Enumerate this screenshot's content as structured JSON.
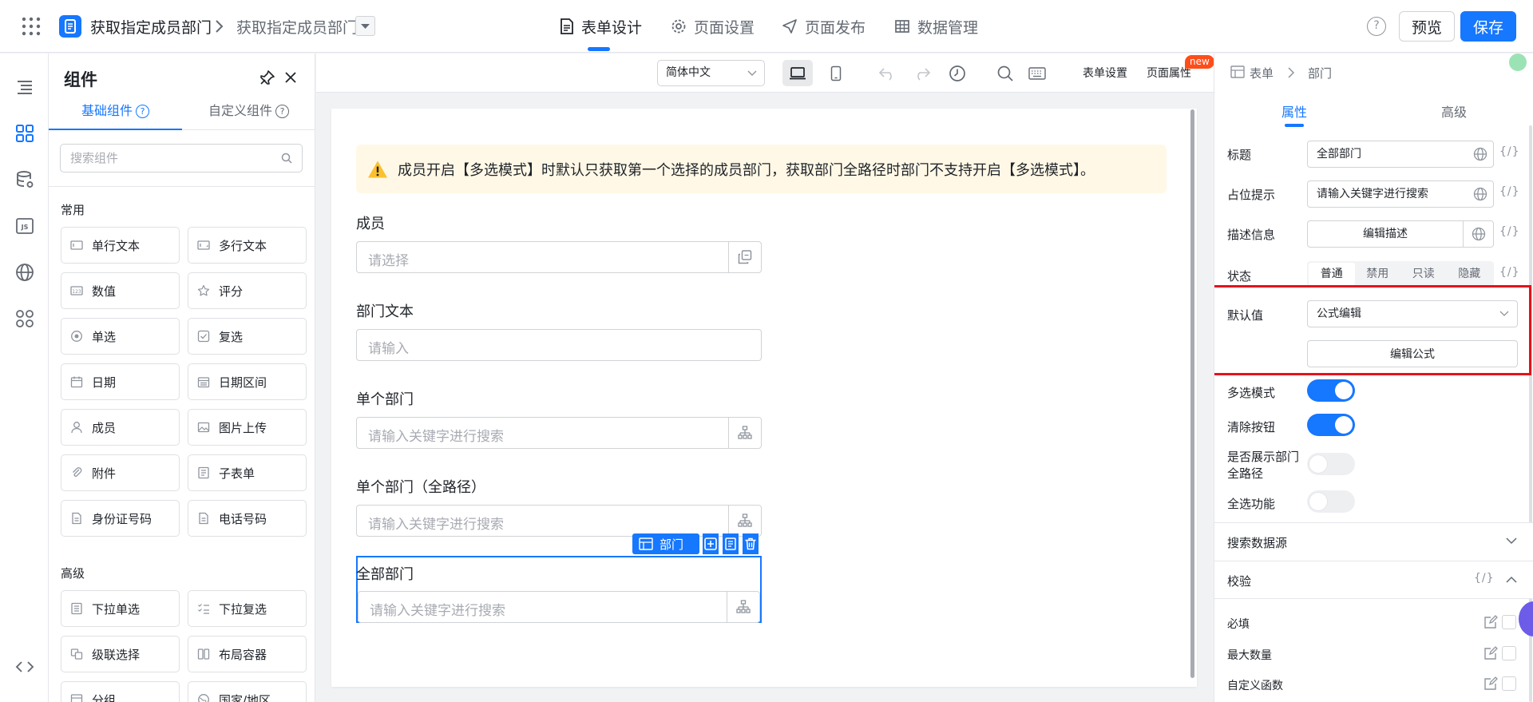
{
  "topbar": {
    "app_name": "获取指定成员部门",
    "page_name": "获取指定成员部门",
    "tabs": [
      {
        "label": "表单设计",
        "icon": "form-doc-icon",
        "active": true
      },
      {
        "label": "页面设置",
        "icon": "gear-icon",
        "active": false
      },
      {
        "label": "页面发布",
        "icon": "send-icon",
        "active": false
      },
      {
        "label": "数据管理",
        "icon": "table-grid-icon",
        "active": false
      }
    ],
    "help": "?",
    "preview_label": "预览",
    "save_label": "保存",
    "accent_color": "#1677ff"
  },
  "rail": {
    "items": [
      "outline-icon",
      "components-icon",
      "datasource-icon",
      "js-icon",
      "globe-icon",
      "apps-icon",
      "code-icon"
    ]
  },
  "components": {
    "title": "组件",
    "tabs": [
      "基础组件",
      "自定义组件"
    ],
    "search_placeholder": "搜索组件",
    "sections": [
      {
        "title": "常用",
        "items": [
          "单行文本",
          "多行文本",
          "数值",
          "评分",
          "单选",
          "复选",
          "日期",
          "日期区间",
          "成员",
          "图片上传",
          "附件",
          "子表单",
          "身份证号码",
          "电话号码"
        ]
      },
      {
        "title": "高级",
        "items": [
          "下拉单选",
          "下拉复选",
          "级联选择",
          "布局容器",
          "分组",
          "国家/地区"
        ]
      }
    ]
  },
  "toolbar": {
    "language": "简体中文",
    "form_settings": "表单设置",
    "page_props": "页面属性",
    "new_badge": "new"
  },
  "canvas": {
    "notice": "成员开启【多选模式】时默认只获取第一个选择的成员部门，获取部门全路径时部门不支持开启【多选模式】。",
    "fields": [
      {
        "label": "成员",
        "placeholder": "请选择"
      },
      {
        "label": "部门文本",
        "placeholder": "请输入"
      },
      {
        "label": "单个部门",
        "placeholder": "请输入关键字进行搜索"
      },
      {
        "label": "单个部门（全路径）",
        "placeholder": "请输入关键字进行搜索"
      },
      {
        "label": "全部部门",
        "placeholder": "请输入关键字进行搜索"
      }
    ],
    "selected_tag": "部门"
  },
  "props": {
    "crumb": [
      "表单",
      "部门"
    ],
    "tabs": [
      "属性",
      "高级"
    ],
    "title_label": "标题",
    "title_value": "全部部门",
    "placeholder_label": "占位提示",
    "placeholder_value": "请输入关键字进行搜索",
    "desc_label": "描述信息",
    "desc_button": "编辑描述",
    "state_label": "状态",
    "state_options": [
      "普通",
      "禁用",
      "只读",
      "隐藏"
    ],
    "state_selected": "普通",
    "fx": "{/}",
    "default_label": "默认值",
    "default_value": "公式编辑",
    "formula_button": "编辑公式",
    "multi_label": "多选模式",
    "multi_on": true,
    "clear_label": "清除按钮",
    "clear_on": true,
    "fullpath_label_1": "是否展示部门",
    "fullpath_label_2": "全路径",
    "fullpath_on": false,
    "selectall_label": "全选功能",
    "selectall_on": false,
    "search_source": "搜索数据源",
    "validation": "校验",
    "validation_rows": [
      "必填",
      "最大数量",
      "自定义函数"
    ],
    "highlight_color": "#e5121b"
  }
}
